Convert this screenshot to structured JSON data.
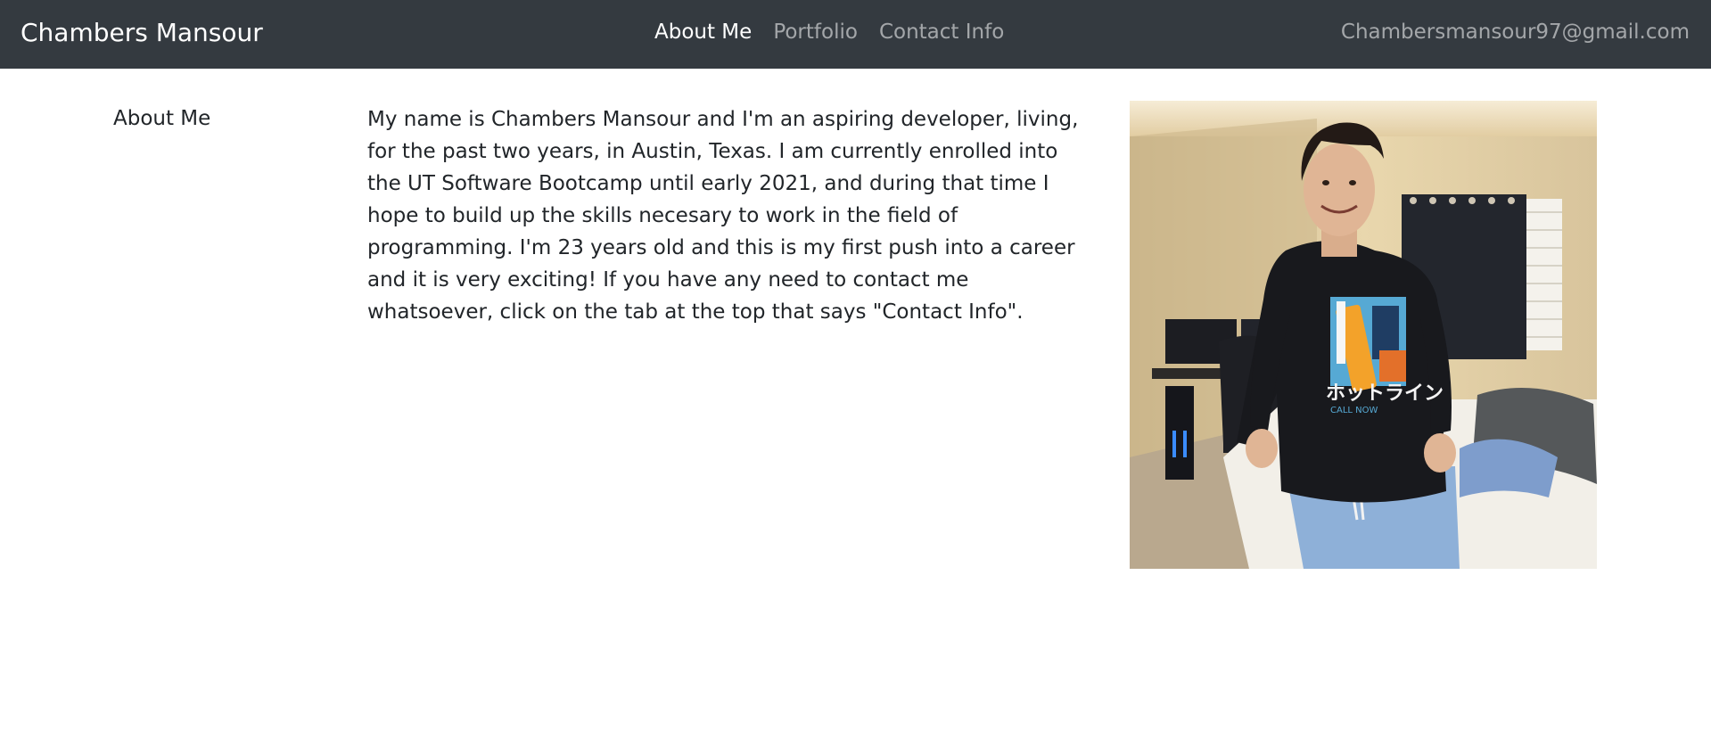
{
  "navbar": {
    "brand": "Chambers Mansour",
    "links": [
      {
        "label": "About Me",
        "active": true
      },
      {
        "label": "Portfolio",
        "active": false
      },
      {
        "label": "Contact Info",
        "active": false
      }
    ],
    "email": "Chambersmansour97@gmail.com"
  },
  "about": {
    "heading": "About Me",
    "bio": "My name is Chambers Mansour and I'm an aspiring developer, living, for the past two years, in Austin, Texas. I am currently enrolled into the UT Software Bootcamp until early 2021, and during that time I hope to build up the skills necesary to work in the field of programming. I'm 23 years old and this is my first push into a career and it is very exciting! If you have any need to contact me whatsoever, click on the tab at the top that says \"Contact Info\"."
  },
  "photo": {
    "shirt_text": "ホットライン",
    "shirt_subtext": "CALL NOW"
  },
  "colors": {
    "navbar_bg": "#343a40",
    "text": "#212529"
  }
}
